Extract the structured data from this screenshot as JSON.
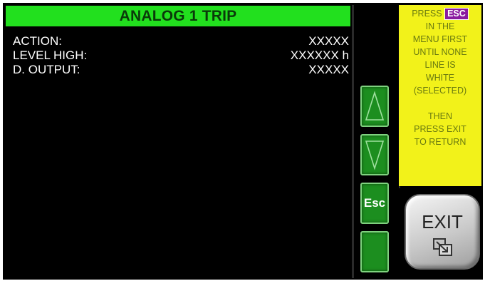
{
  "header": {
    "title": "ANALOG 1 TRIP",
    "title_bg_color": "#22e01e"
  },
  "params": [
    {
      "label": "ACTION:",
      "value": "XXXXX"
    },
    {
      "label": "LEVEL HIGH:",
      "value": "XXXXXX h"
    },
    {
      "label": "D. OUTPUT:",
      "value": "XXXXX"
    }
  ],
  "nav": {
    "up_icon": "triangle-up-icon",
    "down_icon": "triangle-down-icon",
    "esc_label": "Esc",
    "button_color": "#1c8e1f"
  },
  "hint": {
    "line1_prefix": "PRESS",
    "line1_chip": "ESC",
    "line2": "IN THE",
    "line3": "MENU FIRST",
    "line4": "UNTIL NONE",
    "line5": "LINE IS",
    "line6": "WHITE",
    "line7": "(SELECTED)",
    "line8": "THEN",
    "line9": "PRESS EXIT",
    "line10": "TO RETURN",
    "bg_color": "#f2f21a",
    "chip_color": "#8a1aa0"
  },
  "exit": {
    "label": "EXIT",
    "icon": "exit-window-icon"
  }
}
